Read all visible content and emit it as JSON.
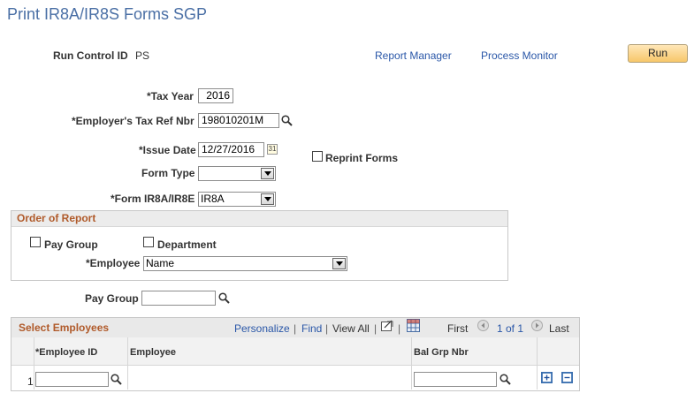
{
  "page": {
    "title": "Print IR8A/IR8S Forms SGP"
  },
  "header": {
    "run_control_label": "Run Control ID",
    "run_control_value": "PS",
    "report_manager": "Report Manager",
    "process_monitor": "Process Monitor",
    "run_label": "Run"
  },
  "form": {
    "tax_year_label": "*Tax Year",
    "tax_year_value": "2016",
    "employer_ref_label": "*Employer's Tax Ref Nbr",
    "employer_ref_value": "198010201M",
    "issue_date_label": "*Issue Date",
    "issue_date_value": "12/27/2016",
    "reprint_label": "Reprint Forms",
    "form_type_label": "Form Type",
    "form_type_value": "",
    "form_ir8a_label": "*Form IR8A/IR8E",
    "form_ir8a_value": "IR8A"
  },
  "order": {
    "title": "Order of Report",
    "pay_group_label": "Pay Group",
    "department_label": "Department",
    "employee_label": "*Employee",
    "employee_value": "Name"
  },
  "pay_group": {
    "label": "Pay Group",
    "value": ""
  },
  "grid": {
    "title": "Select Employees",
    "personalize": "Personalize",
    "find": "Find",
    "view_all": "View All",
    "first": "First",
    "range": "1 of 1",
    "last": "Last",
    "columns": [
      "*Employee ID",
      "Employee",
      "Bal Grp Nbr"
    ],
    "rows": [
      {
        "num": "1",
        "employee_id": "",
        "employee": "",
        "bal_grp": ""
      }
    ]
  },
  "icons": {
    "lookup": "magnifier-icon",
    "calendar": "calendar-icon",
    "add": "plus-icon",
    "remove": "minus-icon"
  }
}
